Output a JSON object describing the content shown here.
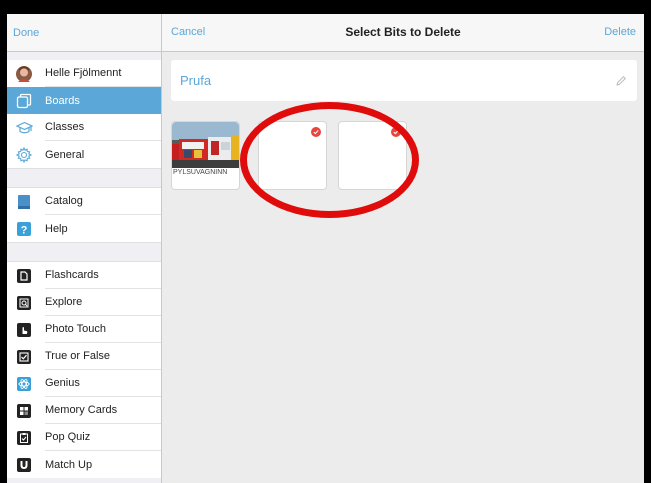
{
  "sidebar": {
    "done_label": "Done",
    "profile": {
      "name": "Helle Fjölmennt",
      "icon": "avatar"
    },
    "top_items": [
      {
        "label": "Boards",
        "icon": "boards-icon",
        "selected": true
      },
      {
        "label": "Classes",
        "icon": "graduation-cap-icon"
      },
      {
        "label": "General",
        "icon": "gear-icon"
      }
    ],
    "mid_items": [
      {
        "label": "Catalog",
        "icon": "book-icon"
      },
      {
        "label": "Help",
        "icon": "help-icon"
      }
    ],
    "game_items": [
      {
        "label": "Flashcards",
        "icon": "flashcards-icon"
      },
      {
        "label": "Explore",
        "icon": "explore-icon"
      },
      {
        "label": "Photo Touch",
        "icon": "hand-icon"
      },
      {
        "label": "True or False",
        "icon": "checkbox-icon"
      },
      {
        "label": "Genius",
        "icon": "atom-icon"
      },
      {
        "label": "Memory Cards",
        "icon": "memory-cards-icon"
      },
      {
        "label": "Pop Quiz",
        "icon": "clipboard-icon"
      },
      {
        "label": "Match Up",
        "icon": "magnet-icon"
      }
    ]
  },
  "header": {
    "cancel_label": "Cancel",
    "title": "Select Bits to Delete",
    "delete_label": "Delete"
  },
  "board": {
    "name": "Prufa",
    "edit_icon": "pencil-icon"
  },
  "bits": [
    {
      "caption": "PYLSUVAGNINN",
      "has_photo": true,
      "selected": false
    },
    {
      "caption": "",
      "has_photo": false,
      "selected": true
    },
    {
      "caption": "",
      "has_photo": false,
      "selected": true
    }
  ],
  "colors": {
    "accent": "#5aa7d8",
    "check": "#e8453c",
    "annotation": "#e00b0b"
  }
}
